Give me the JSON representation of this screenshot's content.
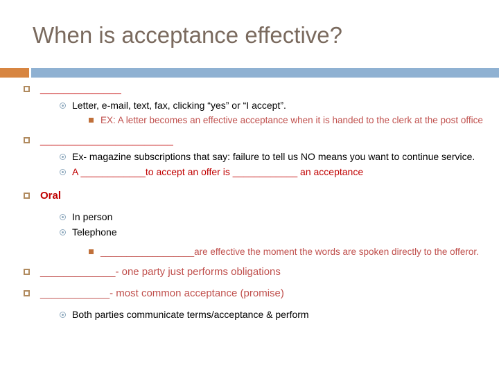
{
  "slide": {
    "title": "When is acceptance effective?",
    "theme": {
      "title_color": "#7A6A5E",
      "accent_orange": "#D78541",
      "accent_blue": "#8FB1D2",
      "bullet1_color": "#B08A5E",
      "bullet2_color": "#8EA9BE",
      "bullet3_color": "#C0703A",
      "text_red": "#C00000",
      "text_salmon": "#C0504D",
      "text_black": "#000000"
    }
  },
  "content": {
    "item1": {
      "blank": "______________"
    },
    "item1_sub1": {
      "text": "Letter, e-mail, text, fax, clicking “yes” or “I accept”."
    },
    "item1_sub1_sub1": {
      "text": "EX: A letter becomes an effective acceptance when it is handed to the clerk at the post office"
    },
    "item2": {
      "blank": "_______________________"
    },
    "item2_sub1": {
      "text": "Ex- magazine subscriptions that say: failure to tell us NO means you want to continue service."
    },
    "item2_sub2": {
      "prefix": "A ",
      "blank1": "____________",
      "middle": "to accept an offer is ",
      "blank2": "____________",
      "suffix": " an acceptance"
    },
    "item3": {
      "label": "Oral"
    },
    "item3_sub1": {
      "text": "In person"
    },
    "item3_sub2": {
      "text": "Telephone"
    },
    "item3_sub2_sub1": {
      "blank": "__________________",
      "text": "are effective the moment the words are spoken directly to the offeror."
    },
    "item4": {
      "blank": "_____________",
      "text": "- one party just performs obligations"
    },
    "item5": {
      "blank": "____________",
      "text": "- most common acceptance (promise)"
    },
    "item5_sub1": {
      "text": "Both parties communicate terms/acceptance & perform"
    }
  }
}
